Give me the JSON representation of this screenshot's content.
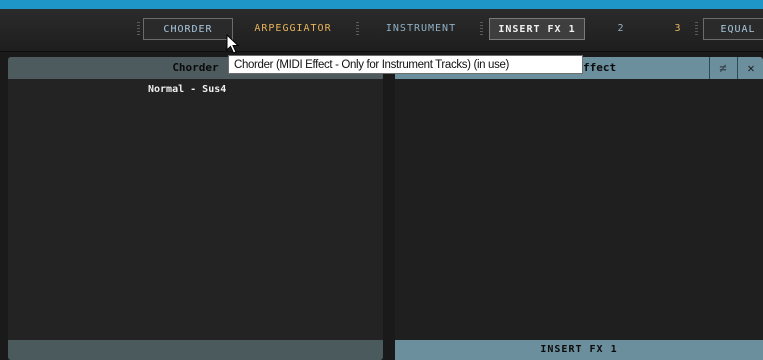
{
  "tabs": [
    {
      "label": "CHORDER",
      "color": "#a9c8df",
      "state": "selected"
    },
    {
      "label": "ARPEGGIATOR",
      "color": "#e6b45a",
      "state": "normal"
    },
    {
      "label": "INSTRUMENT",
      "color": "#8fb0c6",
      "state": "normal"
    },
    {
      "label": "INSERT FX 1",
      "color": "#f0f0f0",
      "state": "active"
    },
    {
      "label": "2",
      "color": "#8fb0c6",
      "state": "normal"
    },
    {
      "label": "3",
      "color": "#e6b45a",
      "state": "normal"
    },
    {
      "label": "EQUAL",
      "color": "#a9c8df",
      "state": "normal"
    }
  ],
  "left_panel": {
    "title": "Chorder",
    "preset": "Normal - Sus4"
  },
  "right_panel": {
    "title_fragment": "ffect",
    "footer": "INSERT FX 1",
    "icons": [
      "not-equal-icon",
      "close-icon"
    ]
  },
  "tooltip": {
    "text": "Chorder (MIDI Effect - Only for Instrument Tracks) (in use)"
  }
}
